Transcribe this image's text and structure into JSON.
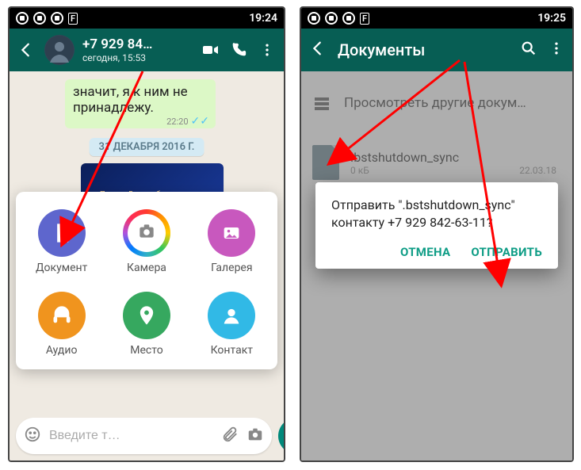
{
  "left": {
    "status_time": "19:24",
    "contact_name": "+7 929 84…",
    "contact_sub": "сегодня, 15:53",
    "msg_text": "значит, я к ним не принадлежу.",
    "msg_time": "22:20",
    "date_pill": "31 ДЕКАБРЯ 2016 Г.",
    "media_caption": "Пусть с Вами в будущем году Произойдёт такая оказия…",
    "compose_placeholder": "Введите т…",
    "attach": {
      "doc": "Документ",
      "cam": "Камера",
      "gal": "Галерея",
      "aud": "Аудио",
      "loc": "Место",
      "con": "Контакт"
    }
  },
  "right": {
    "status_time": "19:25",
    "title": "Документы",
    "browse_label": "Просмотреть другие докум…",
    "file_name": ".bstshutdown_sync",
    "file_size": "0 кБ",
    "file_date": "22.03.18",
    "dialog_text": "Отправить \".bstshutdown_sync\" контакту +7 929 842-63-11?",
    "btn_cancel": "ОТМЕНА",
    "btn_send": "ОТПРАВИТЬ"
  }
}
